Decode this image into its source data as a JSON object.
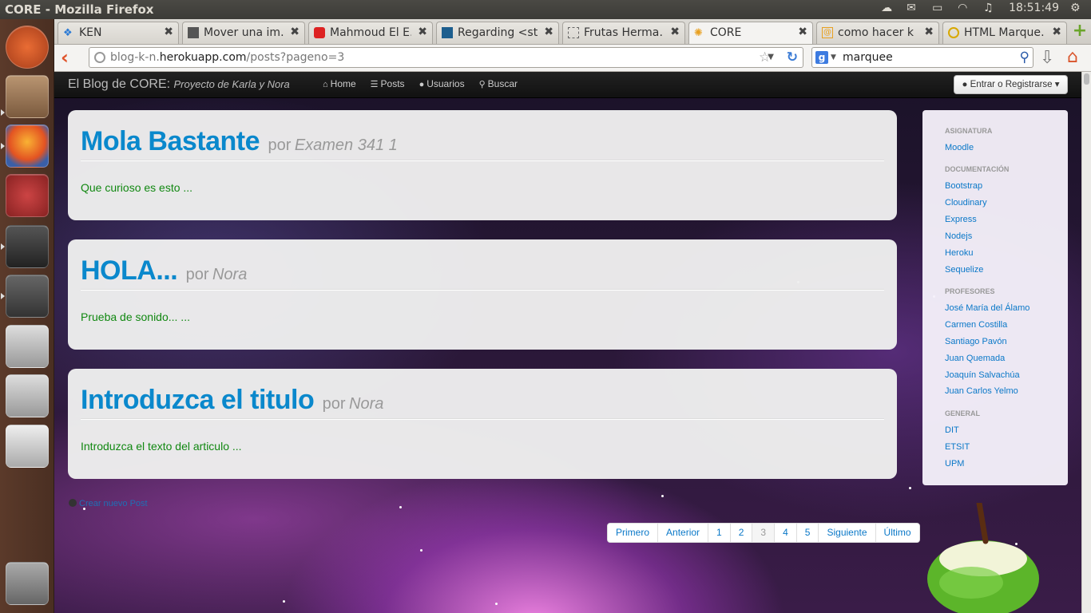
{
  "os": {
    "window_title": "CORE - Mozilla Firefox",
    "clock": "18:51:49"
  },
  "tabs": [
    {
      "label": "KEN"
    },
    {
      "label": "Mover una im…"
    },
    {
      "label": "Mahmoud El E…"
    },
    {
      "label": "Regarding <st…"
    },
    {
      "label": "Frutas Herma…"
    },
    {
      "label": "CORE"
    },
    {
      "label": "como hacer k …"
    },
    {
      "label": "HTML Marque…"
    }
  ],
  "nav": {
    "url_prefix": "blog-k-n.",
    "url_domain": "herokuapp.com",
    "url_path": "/posts?pageno=3",
    "search_query": "marquee"
  },
  "site": {
    "brand": "El Blog de CORE:",
    "brand_sub": "Proyecto de Karla y Nora",
    "links": {
      "home": "Home",
      "posts": "Posts",
      "users": "Usuarios",
      "search": "Buscar"
    },
    "login": "Entrar o Registrarse"
  },
  "posts": [
    {
      "title": "Mola Bastante",
      "por": "por",
      "author": "Examen 341 1",
      "body": "Que curioso es esto ..."
    },
    {
      "title": "HOLA...",
      "por": "por",
      "author": "Nora",
      "body": "Prueba de sonido... ..."
    },
    {
      "title": "Introduzca el titulo",
      "por": "por",
      "author": "Nora",
      "body": "Introduzca el texto del articulo ..."
    }
  ],
  "new_post": "Crear nuevo Post",
  "pager": [
    "Primero",
    "Anterior",
    "1",
    "2",
    "3",
    "4",
    "5",
    "Siguiente",
    "Último"
  ],
  "sidebar": {
    "asignatura": "ASIGNATURA",
    "asignatura_links": [
      "Moodle"
    ],
    "documentacion": "DOCUMENTACIÓN",
    "documentacion_links": [
      "Bootstrap",
      "Cloudinary",
      "Express",
      "Nodejs",
      "Heroku",
      "Sequelize"
    ],
    "profesores": "PROFESORES",
    "profesores_links": [
      "José María del Álamo",
      "Carmen Costilla",
      "Santiago Pavón",
      "Juan Quemada",
      "Joaquín Salvachúa",
      "Juan Carlos Yelmo"
    ],
    "general": "GENERAL",
    "general_links": [
      "DIT",
      "ETSIT",
      "UPM"
    ]
  }
}
